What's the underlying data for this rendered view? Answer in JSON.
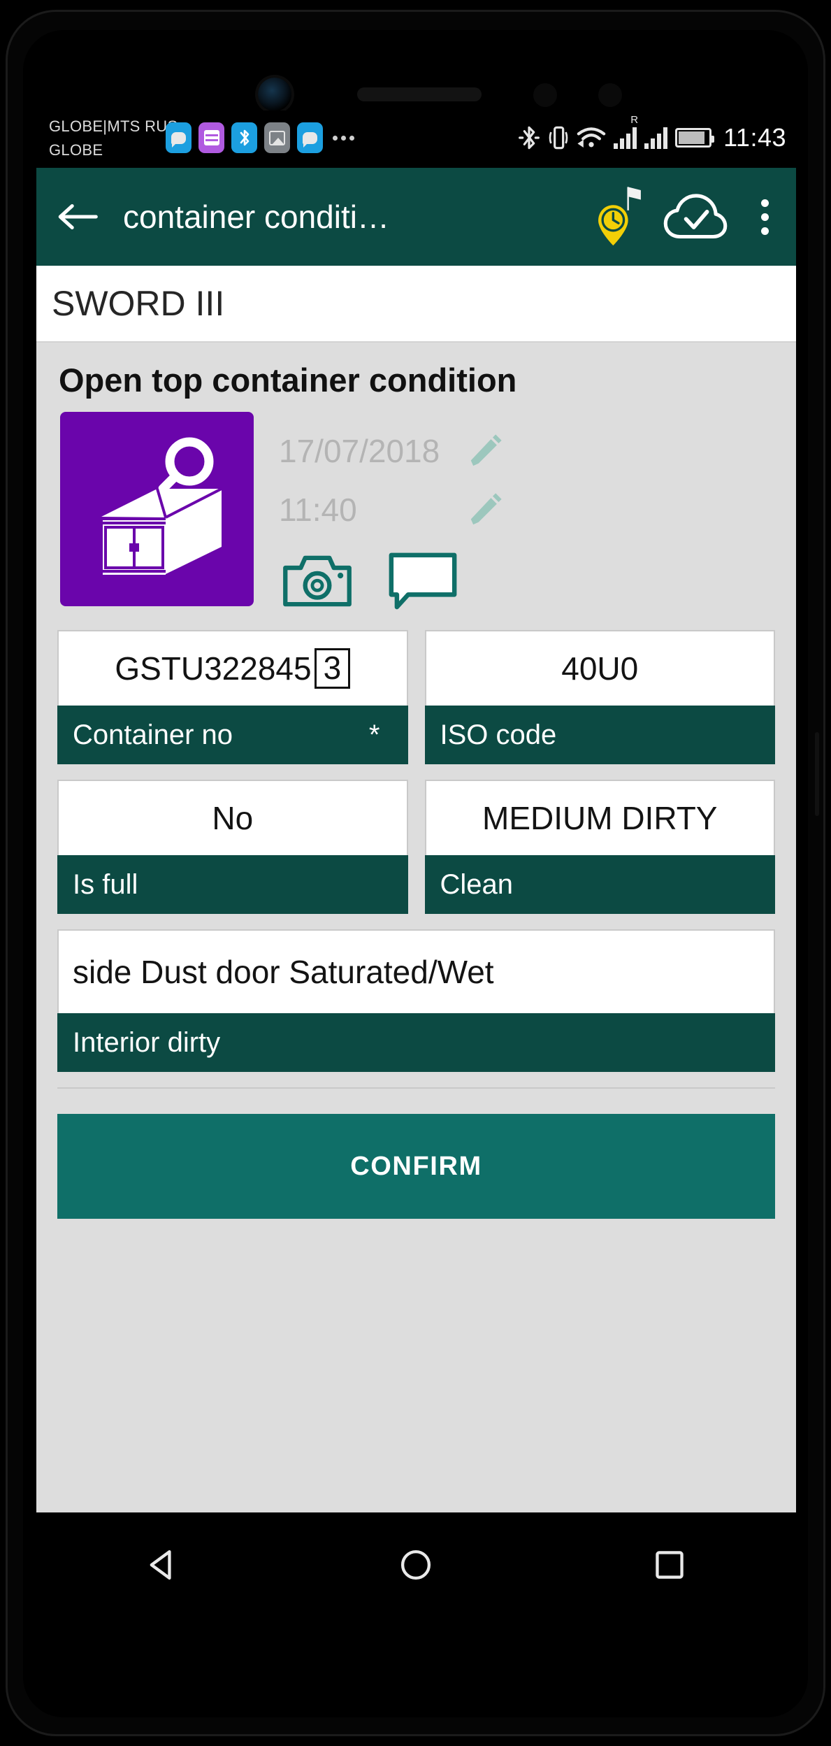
{
  "status_bar": {
    "carrier_line1": "GLOBE|MTS RUS",
    "carrier_line2": "GLOBE",
    "clock": "11:43",
    "roaming_indicator": "R",
    "notification_icons": [
      "message-bubble-icon",
      "list-app-icon",
      "bluetooth-app-icon",
      "gallery-image-icon",
      "message-bubble-icon",
      "more-notifications-icon"
    ],
    "system_icons": [
      "bluetooth-icon",
      "vibrate-icon",
      "wifi-icon",
      "signal-bars-sim1-icon",
      "signal-bars-sim2-icon",
      "battery-icon"
    ]
  },
  "appbar": {
    "back_label": "back",
    "title": "container conditi…",
    "actions": [
      "location-time-pin-icon",
      "cloud-check-icon",
      "overflow-menu-icon"
    ]
  },
  "subheader": {
    "vessel": "SWORD III"
  },
  "main": {
    "section_title": "Open top container condition",
    "thumbnail_icon": "open-top-container-inspection-icon",
    "thumbnail_color": "#6a05ab",
    "date": "17/07/2018",
    "time": "11:40",
    "edit_icon": "pencil-icon",
    "camera_icon": "camera-icon",
    "comment_icon": "comment-icon",
    "fields": [
      {
        "value": "GSTU322845",
        "check_digit": "3",
        "label": "Container no",
        "required_mark": "*"
      },
      {
        "value": "40U0",
        "label": "ISO code",
        "required_mark": ""
      },
      {
        "value": "No",
        "label": "Is full",
        "required_mark": ""
      },
      {
        "value": "MEDIUM DIRTY",
        "label": "Clean",
        "required_mark": ""
      },
      {
        "value": "side Dust door Saturated/Wet",
        "label": "Interior dirty",
        "required_mark": ""
      }
    ],
    "confirm_label": "CONFIRM"
  },
  "navbar": {
    "back_icon": "nav-back-triangle-icon",
    "home_icon": "nav-home-circle-icon",
    "recents_icon": "nav-recents-square-icon"
  },
  "colors": {
    "appbar_green": "#0c4a43",
    "confirm_green": "#0f6f68",
    "thumb_purple": "#6a05ab",
    "pin_yellow": "#f2cf07",
    "content_grey": "#dddddd"
  }
}
